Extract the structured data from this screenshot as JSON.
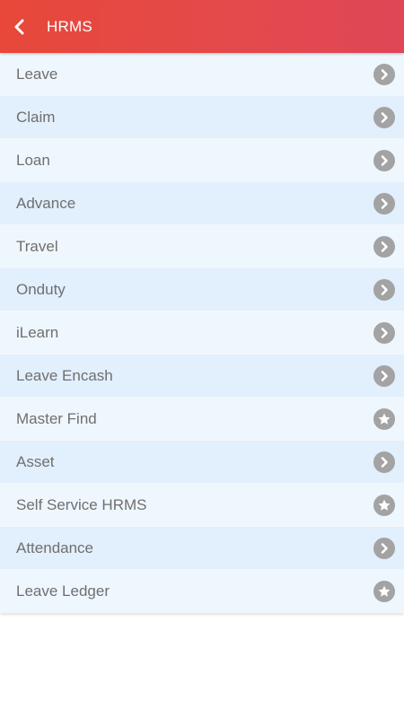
{
  "header": {
    "title": "HRMS",
    "back_icon": "chevron-left-icon",
    "color_start": "#e8473a",
    "color_end": "#df4657"
  },
  "menu": {
    "items": [
      {
        "label": "Leave",
        "icon": "arrow-right-icon"
      },
      {
        "label": "Claim",
        "icon": "arrow-right-icon"
      },
      {
        "label": "Loan",
        "icon": "arrow-right-icon"
      },
      {
        "label": "Advance",
        "icon": "arrow-right-icon"
      },
      {
        "label": "Travel",
        "icon": "arrow-right-icon"
      },
      {
        "label": "Onduty",
        "icon": "arrow-right-icon"
      },
      {
        "label": "iLearn",
        "icon": "arrow-right-icon"
      },
      {
        "label": "Leave Encash",
        "icon": "arrow-right-icon"
      },
      {
        "label": "Master Find",
        "icon": "star-icon"
      },
      {
        "label": "Asset",
        "icon": "arrow-right-icon"
      },
      {
        "label": "Self Service HRMS",
        "icon": "star-icon"
      },
      {
        "label": "Attendance",
        "icon": "arrow-right-icon"
      },
      {
        "label": "Leave Ledger",
        "icon": "star-icon"
      }
    ],
    "row_color_odd": "#eff7fe",
    "row_color_even": "#e2effd",
    "icon_color": "#a3a3a3"
  }
}
